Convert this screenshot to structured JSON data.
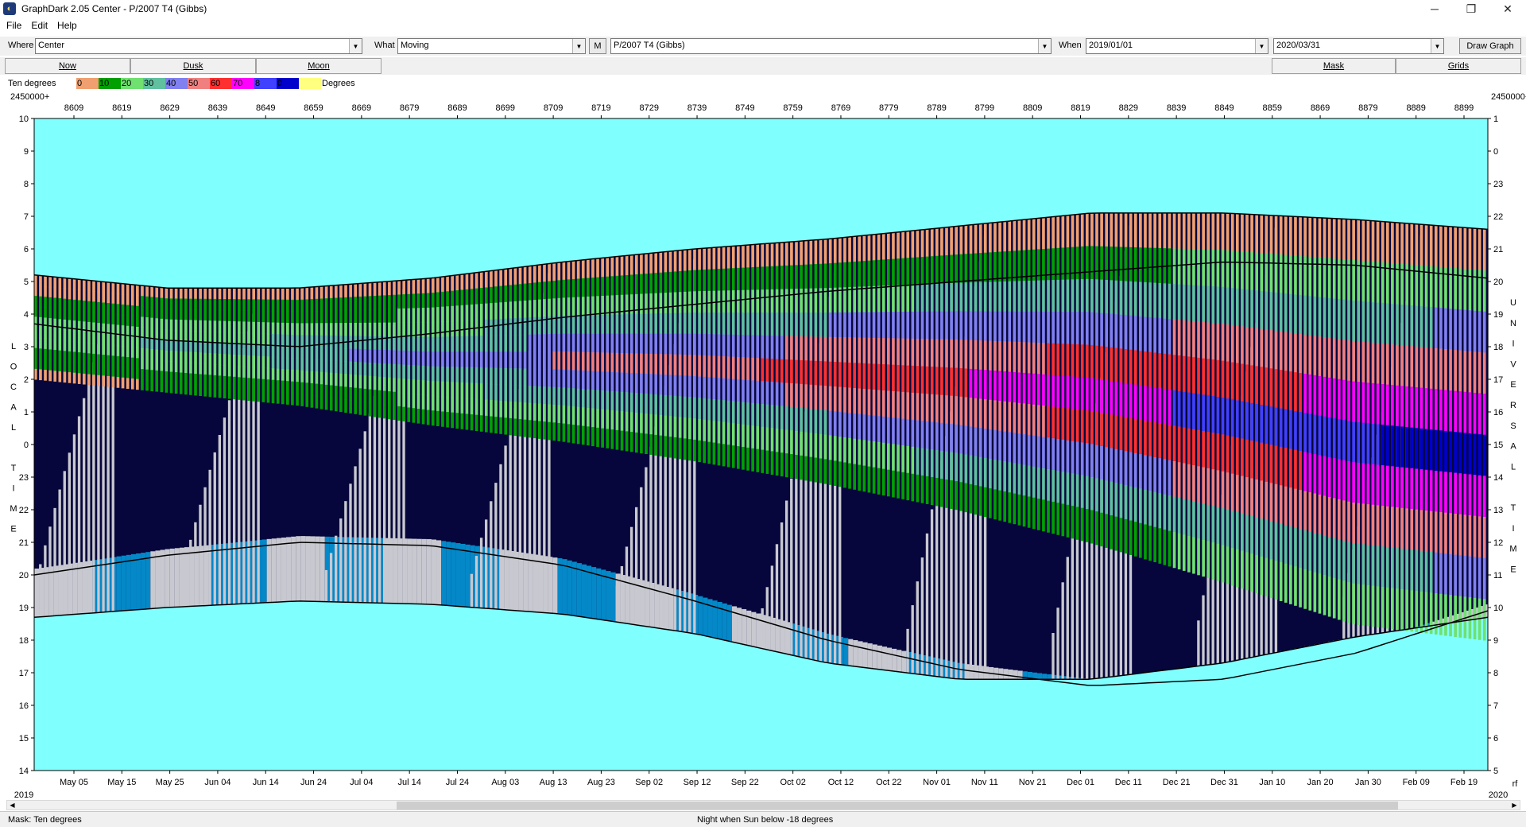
{
  "window": {
    "title": "GraphDark 2.05  Center  -  P/2007 T4 (Gibbs)",
    "icon": "moon-app-icon",
    "minimize": "─",
    "maximize": "❐",
    "close": "✕"
  },
  "menu": [
    "File",
    "Edit",
    "Help"
  ],
  "toolbar": {
    "where_label": "Where",
    "where_value": "Center",
    "what_label": "What",
    "what_value": "Moving",
    "m_button": "M",
    "object_value": "P/2007 T4 (Gibbs)",
    "when_label": "When",
    "start_date": "2019/01/01",
    "end_date": "2020/03/31",
    "draw_button": "Draw Graph"
  },
  "strip": {
    "now": "Now",
    "dusk": "Dusk",
    "moon": "Moon",
    "mask": "Mask",
    "grids": "Grids"
  },
  "legend": {
    "title": "Ten degrees",
    "swatches": [
      {
        "label": "0",
        "color": "#f0a070"
      },
      {
        "label": "10",
        "color": "#00a000"
      },
      {
        "label": "20",
        "color": "#70e070"
      },
      {
        "label": "30",
        "color": "#60c0a0"
      },
      {
        "label": "40",
        "color": "#8080f0"
      },
      {
        "label": "50",
        "color": "#f08080"
      },
      {
        "label": "60",
        "color": "#ff3030"
      },
      {
        "label": "70",
        "color": "#ff00ff"
      },
      {
        "label": "8",
        "color": "#4040ff"
      },
      {
        "label": "0",
        "color": "#0000cc"
      },
      {
        "label": "",
        "color": "#ffff80"
      }
    ],
    "end_label": "Degrees"
  },
  "chart_data": {
    "type": "heatmap",
    "jd_prefix_left": "2450000+",
    "jd_prefix_right": "2450000+",
    "jd_ticks": [
      "8609",
      "8619",
      "8629",
      "8639",
      "8649",
      "8659",
      "8669",
      "8679",
      "8689",
      "8699",
      "8709",
      "8719",
      "8729",
      "8739",
      "8749",
      "8759",
      "8769",
      "8779",
      "8789",
      "8799",
      "8809",
      "8819",
      "8829",
      "8839",
      "8849",
      "8859",
      "8869",
      "8879",
      "8889",
      "8899"
    ],
    "date_ticks": [
      "May 05",
      "May 15",
      "May 25",
      "Jun 04",
      "Jun 14",
      "Jun 24",
      "Jul 04",
      "Jul 14",
      "Jul 24",
      "Aug 03",
      "Aug 13",
      "Aug 23",
      "Sep 02",
      "Sep 12",
      "Sep 22",
      "Oct 02",
      "Oct 12",
      "Oct 22",
      "Nov 01",
      "Nov 11",
      "Nov 21",
      "Dec 01",
      "Dec 11",
      "Dec 21",
      "Dec 31",
      "Jan 10",
      "Jan 20",
      "Jan 30",
      "Feb 09",
      "Feb 19"
    ],
    "year_left": "2019",
    "year_right": "2020",
    "corner_right": "rf",
    "local_time_ticks": [
      "10",
      "9",
      "8",
      "7",
      "6",
      "5",
      "4",
      "3",
      "2",
      "1",
      "0",
      "23",
      "22",
      "21",
      "20",
      "19",
      "18",
      "17",
      "16",
      "15",
      "14"
    ],
    "universal_time_ticks": [
      "1",
      "0",
      "23",
      "22",
      "21",
      "20",
      "19",
      "18",
      "17",
      "16",
      "15",
      "14",
      "13",
      "12",
      "11",
      "10",
      "9",
      "8",
      "7",
      "6",
      "5"
    ],
    "left_axis_label": [
      "L",
      "O",
      "C",
      "A",
      "L",
      "",
      "T",
      "I",
      "M",
      "E"
    ],
    "right_axis_label": [
      "U",
      "N",
      "I",
      "V",
      "E",
      "R",
      "S",
      "A",
      "L",
      "",
      "T",
      "I",
      "M",
      "E"
    ],
    "colors": {
      "day_sky": "#80ffff",
      "night": "#06063c",
      "moonlight": "#c8c8d0",
      "twilight": "#0488c8"
    },
    "dusk_curve": {
      "hours": [
        20.0,
        20.6,
        21.0,
        20.9,
        20.3,
        19.2,
        18.0,
        17.1,
        16.6,
        16.8,
        17.6,
        18.9
      ]
    },
    "dawn_curve": {
      "hours": [
        18.7,
        19.0,
        19.2,
        19.1,
        18.8,
        18.2,
        17.3,
        16.8,
        16.8,
        17.3,
        18.1,
        18.7
      ]
    },
    "object_set_curve": {
      "hours": [
        5.2,
        4.8,
        4.8,
        5.1,
        5.6,
        6.0,
        6.3,
        6.7,
        7.1,
        7.1,
        6.9,
        6.6
      ]
    },
    "object_rise_curve": {
      "hours": [
        3.7,
        3.2,
        3.0,
        3.4,
        3.9,
        4.3,
        4.7,
        5.0,
        5.3,
        5.6,
        5.5,
        5.1
      ]
    },
    "object_lower_curve": {
      "hours": [
        2.0,
        1.6,
        1.2,
        0.6,
        0.1,
        -0.5,
        -1.2,
        -2.0,
        -3.0,
        -4.2,
        -5.5,
        -6.0
      ]
    }
  },
  "status": {
    "mask_text": "Mask:  Ten degrees",
    "night_text": "Night when Sun below -18 degrees"
  }
}
